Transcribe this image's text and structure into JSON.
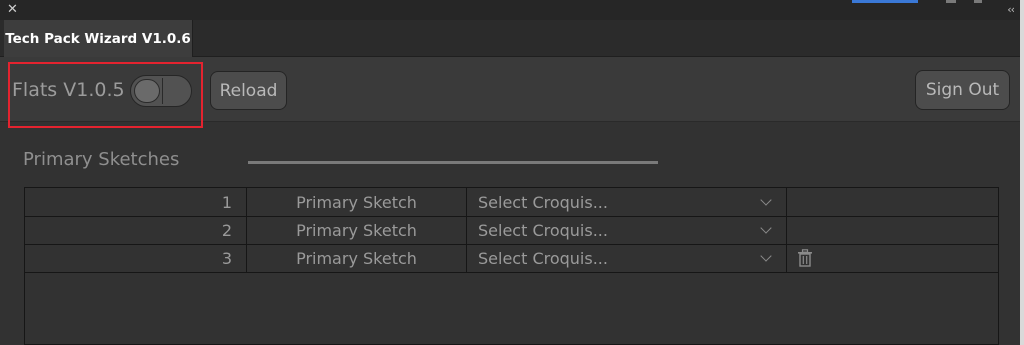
{
  "window": {
    "close_glyph": "✕",
    "collapse_glyph": "‹‹"
  },
  "tab": {
    "label": "Tech Pack Wizard V1.0.6"
  },
  "toolbar": {
    "flats_label": "Flats V1.0.5",
    "toggle_on": false,
    "reload_label": "Reload",
    "signout_label": "Sign Out"
  },
  "section": {
    "title": "Primary Sketches"
  },
  "table": {
    "rows": [
      {
        "num": "1",
        "type": "Primary Sketch",
        "select": "Select Croquis...",
        "has_delete": false
      },
      {
        "num": "2",
        "type": "Primary Sketch",
        "select": "Select Croquis...",
        "has_delete": false
      },
      {
        "num": "3",
        "type": "Primary Sketch",
        "select": "Select Croquis...",
        "has_delete": true
      }
    ]
  },
  "icons": {
    "close": "close-icon",
    "collapse": "collapse-icon",
    "chevron": "chevron-down-icon",
    "delete": "trash-icon"
  },
  "colors": {
    "highlight": "#e4232f",
    "panel": "#323232",
    "accent": "#3a78d6"
  }
}
